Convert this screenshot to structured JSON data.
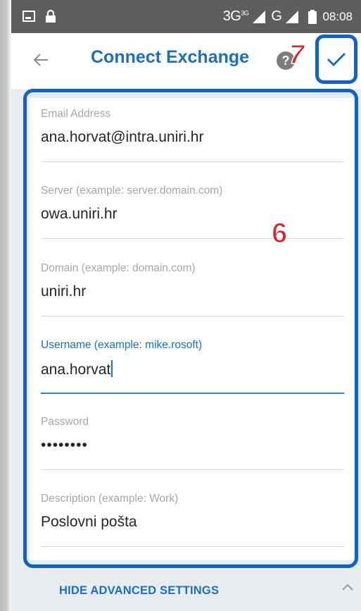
{
  "status_bar": {
    "network": "3G",
    "network_sup": "3G",
    "network2": "G",
    "time": "08:08",
    "icons": [
      "screenshot-icon",
      "lock-icon",
      "signal-icon",
      "battery-icon"
    ]
  },
  "app_bar": {
    "title": "Connect Exchange",
    "back_icon": "back-arrow-icon",
    "help_icon": "help-icon",
    "help_glyph": "?",
    "confirm_icon": "check-icon"
  },
  "annotations": {
    "step_6": "6",
    "step_7": "7",
    "marker_color": "#d8242a",
    "outline_color": "#0d63c9"
  },
  "form": {
    "email": {
      "label": "Email Address",
      "value": "ana.horvat@intra.uniri.hr"
    },
    "server": {
      "label": "Server (example: server.domain.com)",
      "value": "owa.uniri.hr"
    },
    "domain": {
      "label": "Domain (example: domain.com)",
      "value": "uniri.hr"
    },
    "username": {
      "label": "Username (example: mike.rosoft)",
      "value": "ana.horvat"
    },
    "password": {
      "label": "Password",
      "value": "••••••••"
    },
    "description": {
      "label": "Description (example: Work)",
      "value": "Poslovni pošta"
    }
  },
  "advanced": {
    "label": "HIDE ADVANCED SETTINGS",
    "icon": "chevron-up-icon"
  },
  "colors": {
    "accent": "#1a6fc0",
    "status_bar": "#5e5e5e"
  }
}
